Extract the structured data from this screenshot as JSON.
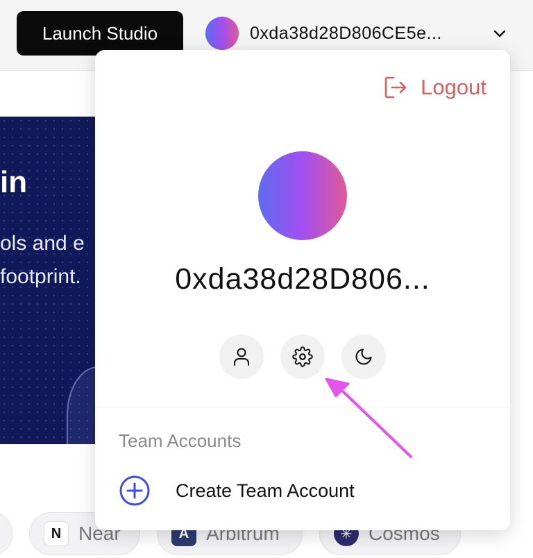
{
  "topbar": {
    "launch_label": "Launch Studio",
    "wallet_address": "0xda38d28D806CE5e..."
  },
  "hero": {
    "title": "in",
    "line1": "ols and e",
    "line2": "footprint."
  },
  "chips": [
    {
      "label": "Near",
      "icon": "near-logo-icon"
    },
    {
      "label": "Arbitrum",
      "icon": "arbitrum-logo-icon"
    },
    {
      "label": "Cosmos",
      "icon": "cosmos-logo-icon"
    }
  ],
  "dropdown": {
    "logout_label": "Logout",
    "address": "0xda38d28D806...",
    "icon_buttons": [
      "user-icon",
      "gear-icon",
      "moon-icon"
    ],
    "team_heading": "Team Accounts",
    "create_team_label": "Create Team Account"
  },
  "colors": {
    "logout": "#d9605c",
    "create_plus": "#3b4df0",
    "annotation_arrow": "#e554e8",
    "avatar_gradient": [
      "#5f6cf0",
      "#a24ff0",
      "#e05a96"
    ]
  }
}
